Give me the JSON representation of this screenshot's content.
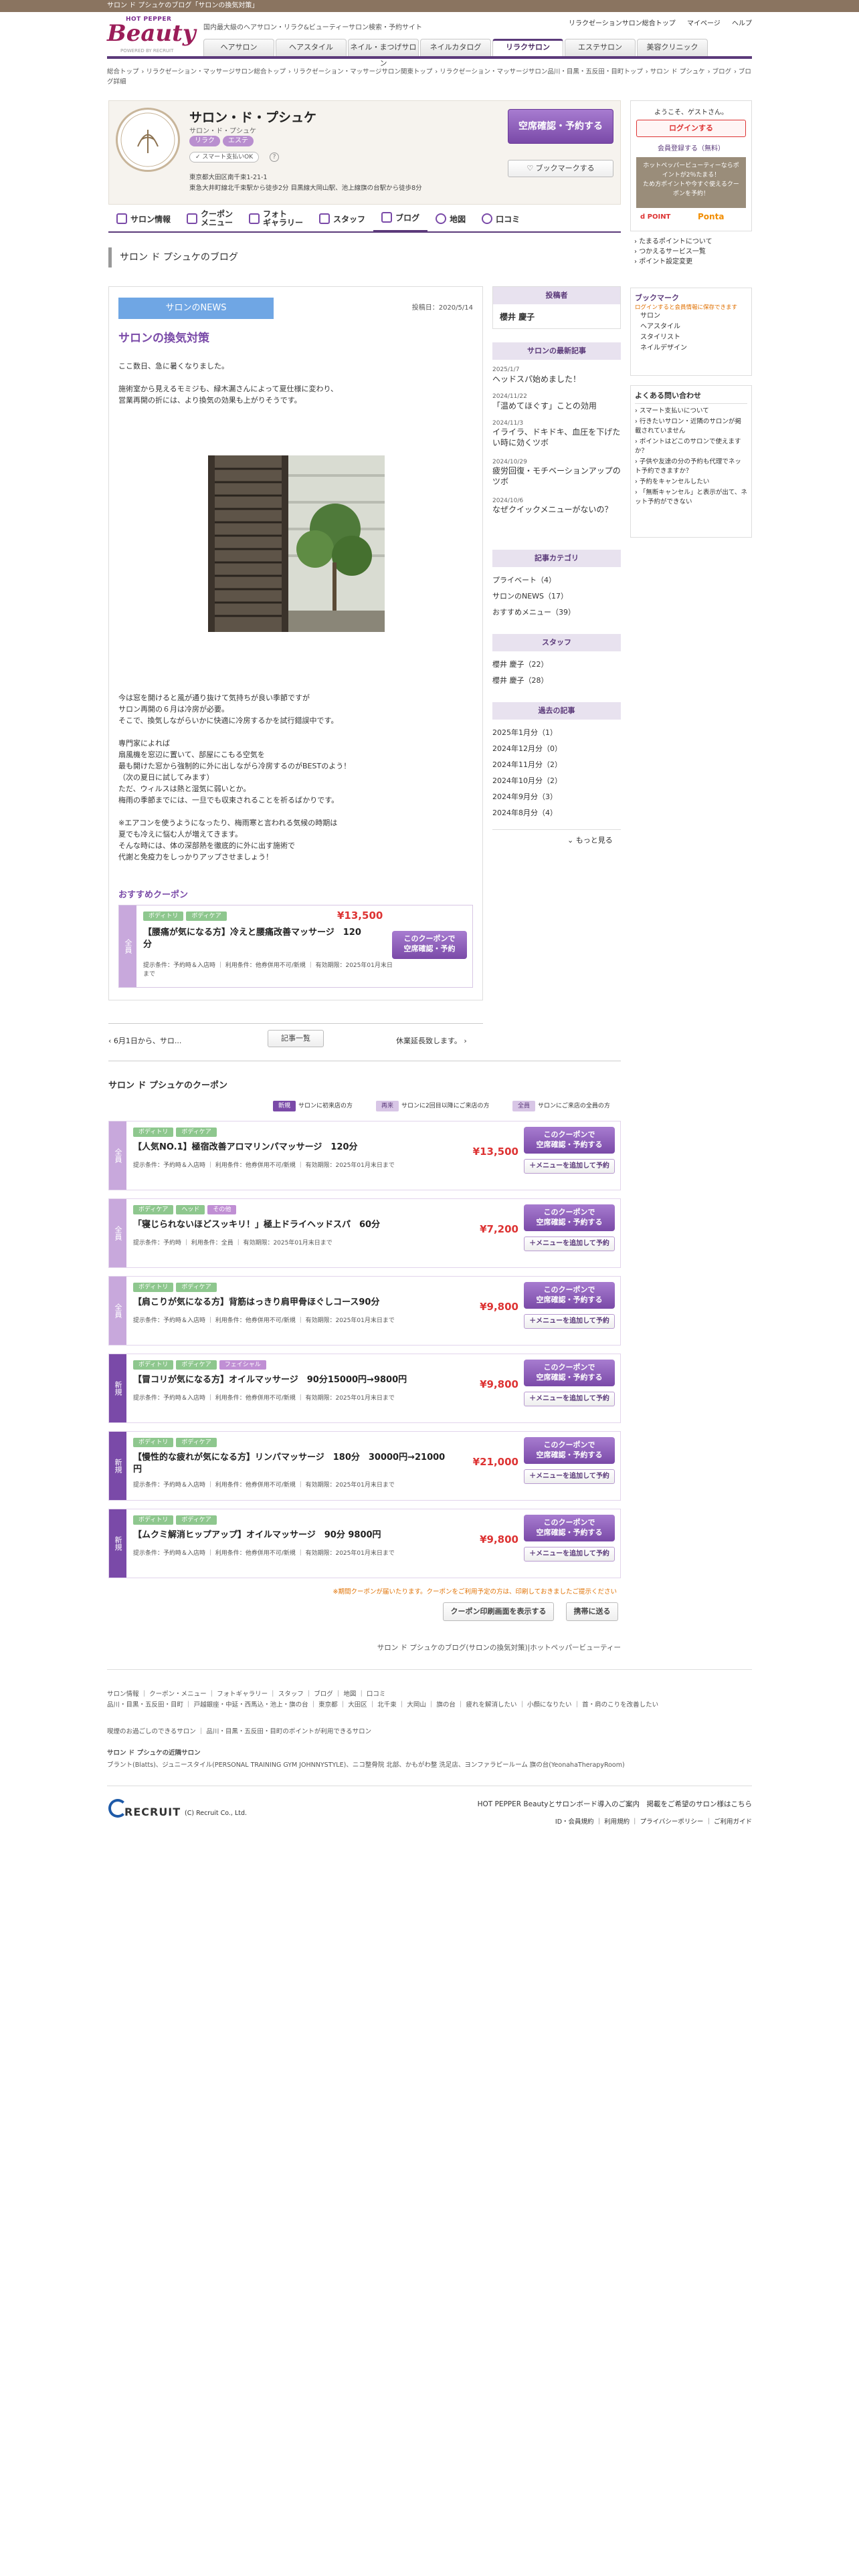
{
  "topbar": {
    "text": "サロン ド プシュケのブログ「サロンの換気対策」"
  },
  "header": {
    "brand_top": "HOT PEPPER",
    "brand": "Beauty",
    "powered": "POWERED BY RECRUIT",
    "tagline": "国内最大級のヘアサロン・リラク&ビューティーサロン検索・予約サイト",
    "links": [
      "リラクゼーションサロン総合トップ",
      "マイページ",
      "ヘルプ"
    ],
    "nav": [
      "ヘアサロン",
      "ヘアスタイル",
      "ネイル・まつげサロン",
      "ネイルカタログ",
      "リラクサロン",
      "エステサロン",
      "美容クリニック"
    ]
  },
  "breadcrumb": [
    "総合トップ",
    "リラクゼーション・マッサージサロン総合トップ",
    "リラクゼーション・マッサージサロン関東トップ",
    "リラクゼーション・マッサージサロン品川・目黒・五反田・目町トップ",
    "サロン ド プシュケ",
    "ブログ",
    "ブログ詳細"
  ],
  "salon": {
    "name": "サロン・ド・プシュケ",
    "kana": "サロン・ド・プシュケ",
    "tags": [
      "リラク",
      "エステ"
    ],
    "payment": "スマート支払いOK",
    "address1": "東京都大田区南千束1-21-1",
    "address2": "東急大井町線北千束駅から徒歩2分 目黒線大岡山駅、池上線旗の台駅から徒歩8分",
    "reserve_btn": "空席確認・予約する",
    "bookmark_btn": "ブックマークする"
  },
  "tabs": [
    "サロン情報",
    "クーポン\nメニュー",
    "フォト\nギャラリー",
    "スタッフ",
    "ブログ",
    "地図",
    "口コミ"
  ],
  "page_title": "サロン ド プシュケのブログ",
  "blog": {
    "category": "サロンのNEWS",
    "date": "投稿日：2020/5/14",
    "title": "サロンの換気対策",
    "p1": [
      "ここ数日、急に暑くなりました。",
      "",
      "施術室から見えるモミジも、緑木漏さんによって夏仕様に変わり、",
      "営業再開の折には、より換気の効果も上がりそうです。"
    ],
    "p2": [
      "今は窓を開けると風が通り抜けて気持ちが良い季節ですが",
      "サロン再開の６月は冷房が必要。",
      "そこで、換気しながらいかに快適に冷房するかを試行錯誤中です。",
      "",
      "専門家によれば",
      "扇風機を窓辺に置いて、部屋にこもる空気を",
      "最も開けた窓から強制的に外に出しながら冷房するのがBESTのよう！",
      "（次の夏日に試してみます）",
      "ただ、ウィルスは熱と湿気に弱いとか。",
      "梅雨の季節までには、一旦でも収束されることを祈るばかりです。",
      "",
      "※エアコンを使うようになったり、梅雨寒と言われる気候の時期は",
      "夏でも冷えに悩む人が増えてきます。",
      "そんな時には、体の深部熱を徹底的に外に出す施術で",
      "代謝と免疫力をしっかりアップさせましょう！"
    ],
    "recommend_label": "おすすめクーポン",
    "recommend": {
      "side": "全員",
      "tags": [
        "ボディトリ",
        "ボディケア"
      ],
      "title": "【腰痛が気になる方】冷えと腰痛改善マッサージ　120分",
      "price": "¥13,500",
      "cond": "提示条件：予約時＆入店時 ｜ 利用条件：他券併用不可/新規 ｜ 有効期限：2025年01月末日まで",
      "btn": "このクーポンで\n空席確認・予約"
    },
    "prev": "6月1日から、サロ...",
    "list_btn": "記事一覧",
    "next": "休業延長致します。"
  },
  "right": {
    "author_head": "投稿者",
    "author": "櫻井 慶子",
    "latest_head": "サロンの最新記事",
    "latest": [
      {
        "date": "2025/1/7",
        "title": "ヘッドスパ始めました！"
      },
      {
        "date": "2024/11/22",
        "title": "「温めてほぐす」ことの効用"
      },
      {
        "date": "2024/11/3",
        "title": "イライラ、ドキドキ、血圧を下げたい時に効くツボ"
      },
      {
        "date": "2024/10/29",
        "title": "疲労回復・モチベーションアップのツボ"
      },
      {
        "date": "2024/10/6",
        "title": "なぜクイックメニューがないの？"
      }
    ],
    "cat_head": "記事カテゴリ",
    "cats": [
      "プライベート（4）",
      "サロンのNEWS（17）",
      "おすすめメニュー（39）"
    ],
    "staff_head": "スタッフ",
    "staff": [
      "櫻井 慶子（22）",
      "櫻井 慶子（28）"
    ],
    "archive_head": "過去の記事",
    "archive": [
      "2025年1月分（1）",
      "2024年12月分（0）",
      "2024年11月分（2）",
      "2024年10月分（2）",
      "2024年9月分（3）",
      "2024年8月分（4）"
    ],
    "more": "もっと見る"
  },
  "far": {
    "welcome": "ようこそ、ゲストさん。",
    "login": "ログインする",
    "register": "会員登録する（無料）",
    "promo": "ホットペッパービューティーならポイントが2％たまる！\nため方ポイントや今すぐ使えるクーポンを予約！",
    "ponta": "Ponta",
    "dpoint": "d POINT",
    "links1": [
      "たまるポイントについて",
      "つかえるサービス一覧",
      "ポイント設定変更"
    ],
    "bookmark_head": "ブックマーク",
    "bookmark_note": "ログインすると会員情報に保存できます",
    "bookmark_items": [
      "サロン",
      "ヘアスタイル",
      "スタイリスト",
      "ネイルデザイン"
    ],
    "faq_head": "よくある問い合わせ",
    "faq": [
      "スマート支払いについて",
      "行きたいサロン・近隣のサロンが掲載されていません",
      "ポイントはどこのサロンで使えますか？",
      "子供や友達の分の予約も代理でネット予約できますか？",
      "予約をキャンセルしたい",
      "「無断キャンセル」と表示が出て、ネット予約ができない"
    ]
  },
  "couponlist": {
    "head": "サロン ド プシュケのクーポン",
    "legend": [
      {
        "tag": "新規",
        "text": "サロンに初来店の方"
      },
      {
        "tag": "再来",
        "text": "サロンに2回目以降にご来店の方"
      },
      {
        "tag": "全員",
        "text": "サロンにご来店の全員の方"
      }
    ],
    "items": [
      {
        "side": "全員",
        "tags": [
          "ボディトリ",
          "ボディケア"
        ],
        "title": "【人気NO.1】極宿改善アロマリンパマッサージ　120分",
        "price": "¥13,500",
        "cond": "提示条件：予約時＆入店時 ｜ 利用条件：他券併用不可/新規 ｜ 有効期限：2025年01月末日まで"
      },
      {
        "side": "全員",
        "tags": [
          "ボディケア",
          "ヘッド",
          "その他"
        ],
        "title": "「寝じられないほどスッキリ！」極上ドライヘッドスパ　60分",
        "price": "¥7,200",
        "cond": "提示条件：予約時 ｜ 利用条件：全員 ｜ 有効期限：2025年01月末日まで"
      },
      {
        "side": "全員",
        "tags": [
          "ボディトリ",
          "ボディケア"
        ],
        "title": "【肩こりが気になる方】背筋はっきり肩甲骨ほぐしコース90分",
        "price": "¥9,800",
        "cond": "提示条件：予約時＆入店時 ｜ 利用条件：他券併用不可/新規 ｜ 有効期限：2025年01月末日まで"
      },
      {
        "side": "新規",
        "tags": [
          "ボディトリ",
          "ボディケア",
          "フェイシャル"
        ],
        "title": "【冒コリが気になる方】オイルマッサージ　90分15000円→9800円",
        "price": "¥9,800",
        "cond": "提示条件：予約時＆入店時 ｜ 利用条件：他券併用不可/新規 ｜ 有効期限：2025年01月末日まで"
      },
      {
        "side": "新規",
        "tags": [
          "ボディトリ",
          "ボディケア"
        ],
        "title": "【慢性的な疲れが気になる方】リンパマッサージ　180分　30000円→21000円",
        "price": "¥21,000",
        "cond": "提示条件：予約時＆入店時 ｜ 利用条件：他券併用不可/新規 ｜ 有効期限：2025年01月末日まで"
      },
      {
        "side": "新規",
        "tags": [
          "ボディトリ",
          "ボディケア"
        ],
        "title": "【ムクミ解消ヒップアップ】オイルマッサージ　90分 9800円",
        "price": "¥9,800",
        "cond": "提示条件：予約時＆入店時 ｜ 利用条件：他券併用不可/新規 ｜ 有効期限：2025年01月末日まで"
      }
    ],
    "btn1": "このクーポンで\n空席確認・予約する",
    "btn2": "＋メニューを追加して予約",
    "note": "※期間クーポンが届いたります。クーポンをご利用予定の方は、印刷しておきましたご提示ください",
    "print_btn": "クーポン印刷画面を表示する",
    "mobile_btn": "携帯に送る",
    "caption": "サロン ド プシュケのブログ(サロンの換気対策)|ホットペッパービューティー"
  },
  "footer": {
    "links1": [
      "サロン情報",
      "クーポン・メニュー",
      "フォトギャラリー",
      "スタッフ",
      "ブログ",
      "地図",
      "口コミ"
    ],
    "areas": [
      "品川・目黒・五反田・目町",
      "戸越銀座・中延・西馬込・池上・旗の台",
      "東京都",
      "大田区",
      "北千束",
      "大岡山",
      "旗の台",
      "疲れを解消したい",
      "小顔になりたい",
      "首・肩のこりを改善したい"
    ],
    "line2": [
      "喫煙のお過ごしのできるサロン",
      "品川・目黒・五反田・目町のポイントが利用できるサロン"
    ],
    "sister_head": "サロン ド プシュケの近隣サロン",
    "sister": "ブラント(Blatts)、ジュニースタイル(PERSONAL TRAINING GYM JOHNNYSTYLE)、ニコ整骨院 北部、かもがわ整 洗足店、ヨンファラピールーム 旗の台(YeonahaTherapyRoom)",
    "recruit": "RECRUIT",
    "copyright": "(C) Recruit Co., Ltd.",
    "right1": "HOT PEPPER Beautyとサロンボード導入のご案内　掲載をご希望のサロン様はこちら",
    "right2": [
      "ID・会員規約",
      "利用規約",
      "プライバシーポリシー",
      "ご利用ガイド"
    ]
  }
}
